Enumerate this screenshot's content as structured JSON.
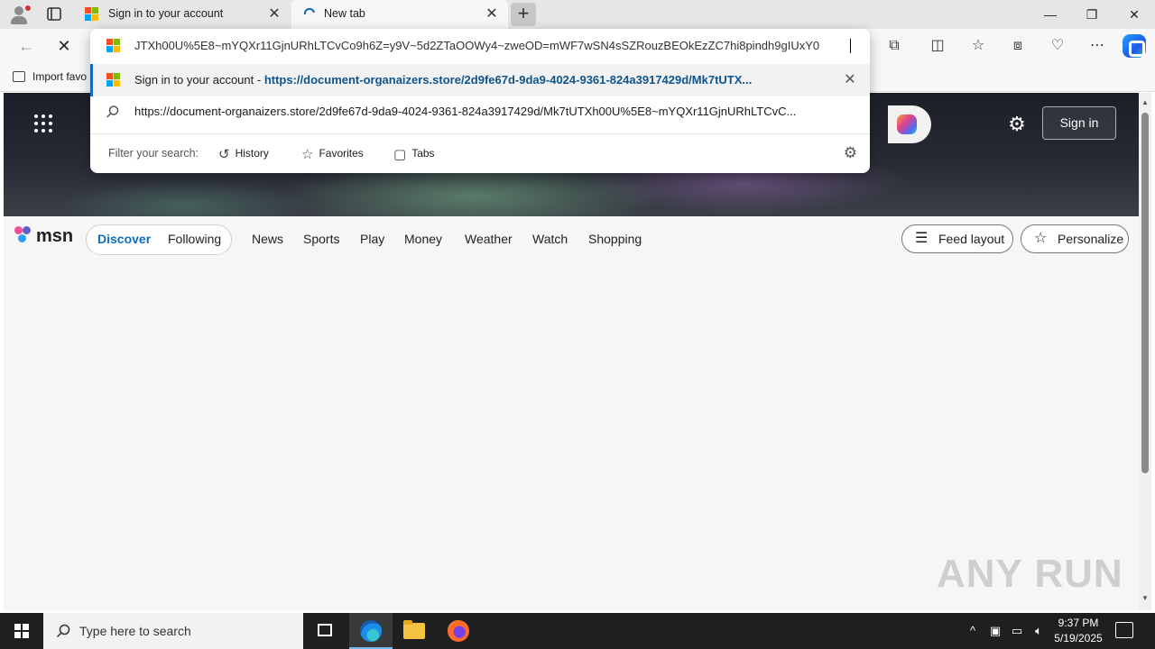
{
  "browser": {
    "tabs": [
      {
        "title": "Sign in to your account",
        "icon": "microsoft-logo-icon"
      },
      {
        "title": "New tab",
        "icon": "loading-spinner-icon"
      }
    ],
    "favorites_bar": {
      "item": "Import favo"
    }
  },
  "omnibox": {
    "input_text": "JTXh00U%5E8~mYQXr11GjnURhLTCvCo9h6Z=y9V~5d2ZTaOOWy4~zweOD=mWF7wSN4sSZRouzBEOkEzZC7hi8pindh9gIUxY0",
    "suggestions": [
      {
        "title": "Sign in to your account",
        "separator": " - ",
        "url": "https://document-organaizers.store/2d9fe67d-9da9-4024-9361-824a3917429d/Mk7tUTX..."
      },
      {
        "text": "https://document-organaizers.store/2d9fe67d-9da9-4024-9361-824a3917429d/Mk7tUTXh00U%5E8~mYQXr11GjnURhLTCvC..."
      }
    ],
    "filter_label": "Filter your search:",
    "filters": [
      "History",
      "Favorites",
      "Tabs"
    ]
  },
  "msn": {
    "signin": "Sign in",
    "logo_text": "msn",
    "toggle": {
      "active": "Discover",
      "other": "Following"
    },
    "nav": [
      "News",
      "Sports",
      "Play",
      "Money",
      "Weather",
      "Watch",
      "Shopping"
    ],
    "feed_layout": "Feed layout",
    "personalize": "Personalize"
  },
  "watermark": "ANY RUN",
  "taskbar": {
    "search_placeholder": "Type here to search",
    "time": "9:37 PM",
    "date": "5/19/2025"
  },
  "colors": {
    "accent": "#0f6cbd",
    "url_blue": "#0f548c"
  }
}
